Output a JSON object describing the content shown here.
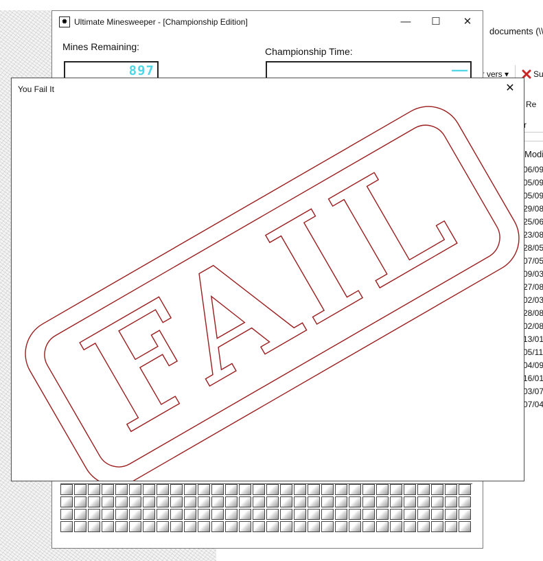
{
  "minesweeper": {
    "title": "Ultimate Minesweeper - [Championship Edition]",
    "mines_label": "Mines Remaining:",
    "mines_value": "897",
    "time_label": "Championship Time:",
    "time_value": "——",
    "window_controls": {
      "minimize": "—",
      "maximize": "☐",
      "close": "✕"
    },
    "board": {
      "columns": 30,
      "visible_rows": 4
    }
  },
  "dialog": {
    "title": "You Fail It",
    "close": "✕",
    "stamp_text": "FAIL",
    "stamp_color": "#9b1c1c"
  },
  "explorer": {
    "title": "documents (\\\\",
    "toolbar_versions": "er vers ▾",
    "toolbar_delete": "Sup",
    "toolbar_rename": "Re",
    "filter_fragment": "r",
    "column_header": "Modi",
    "dates": [
      "06/09",
      "05/09",
      "05/09",
      "29/08",
      "25/06",
      "23/08",
      "28/05",
      "07/05",
      "09/03",
      "27/08",
      "02/03",
      "28/08",
      "02/08",
      "13/01",
      "05/11",
      "04/09",
      "16/01",
      "03/07",
      "07/04"
    ]
  }
}
